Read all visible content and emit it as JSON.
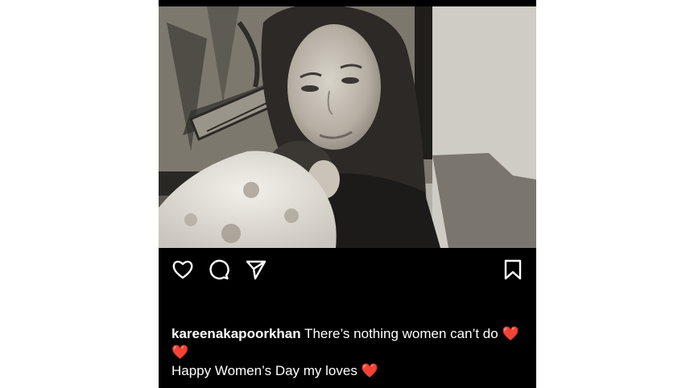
{
  "post": {
    "photo": {
      "description_icon": "photo-image"
    },
    "actions": {
      "like_icon": "heart-outline-icon",
      "comment_icon": "comment-bubble-icon",
      "share_icon": "paper-plane-icon",
      "save_icon": "bookmark-icon"
    },
    "caption": {
      "username": "kareenakapoorkhan",
      "line1_text": " There’s nothing women can’t do ",
      "heart1": "❤️",
      "heart2": "❤️",
      "line2_text": "Happy Women’s Day my loves ",
      "heart3": "❤️"
    }
  },
  "colors": {
    "background": "#000000",
    "text": "#ffffff",
    "heart": "#e8202a"
  }
}
